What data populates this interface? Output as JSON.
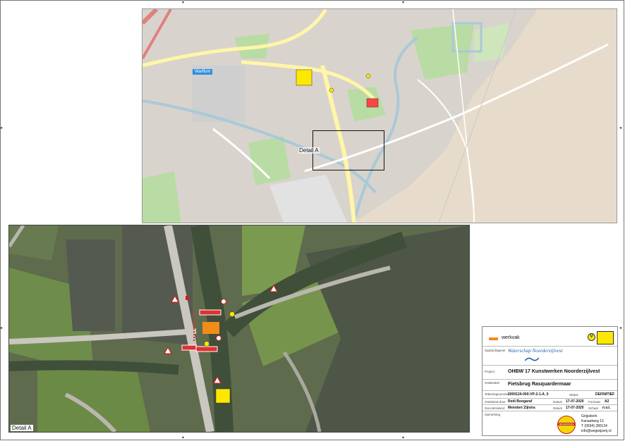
{
  "map_top": {
    "place_label": "Warffum",
    "detail_label": "Detail A"
  },
  "aerial": {
    "label": "Detail A"
  },
  "legend": {
    "werkvak_label": "werkvak",
    "opdrachtgever_key": "Opdrachtgever",
    "opdrachtgever_name": "Waterschap Noorderzijlvest",
    "project_key": "Project",
    "project_value": "OHBW 17 Kunstwerken Noorderzijlvest",
    "onderdeel_key": "Onderdeel",
    "onderdeel_value": "Fietsbrug Rasquardermaar",
    "tekening_key": "Tekeningnummer",
    "tekening_value": "2000124-000-VP-2-1-A_0",
    "status_key": "Status",
    "status_value": "DEFINITIEF",
    "getekend_key": "Getekend door",
    "getekend_value": "Redi Boogaraf",
    "datum1_key": "Datum",
    "datum1_value": "17-07-2020",
    "formaat_key": "Formaat",
    "formaat_value": "A2",
    "gecontroleerd_key": "Gecontroleerd",
    "gecontroleerd_value": "Meindert Zijlstra",
    "datum2_key": "Datum",
    "datum2_value": "17-07-2020",
    "schaal_key": "Schaal",
    "schaal_value": "n.v.t.",
    "opmerking_key": "Opmerking",
    "company_line1": "Grijpskerk",
    "company_line2": "Kanaalweg 13",
    "company_line3": "T (0594) 280124",
    "company_line4": "info@wegwijzerij.nl",
    "logo_text": "WEGWIJZERIJ",
    "v_badge": "V"
  },
  "colors": {
    "werkvak": "#f28c1a",
    "roads": "#fff6a8",
    "water": "#a9c9d8",
    "green": "#b9dca4"
  }
}
